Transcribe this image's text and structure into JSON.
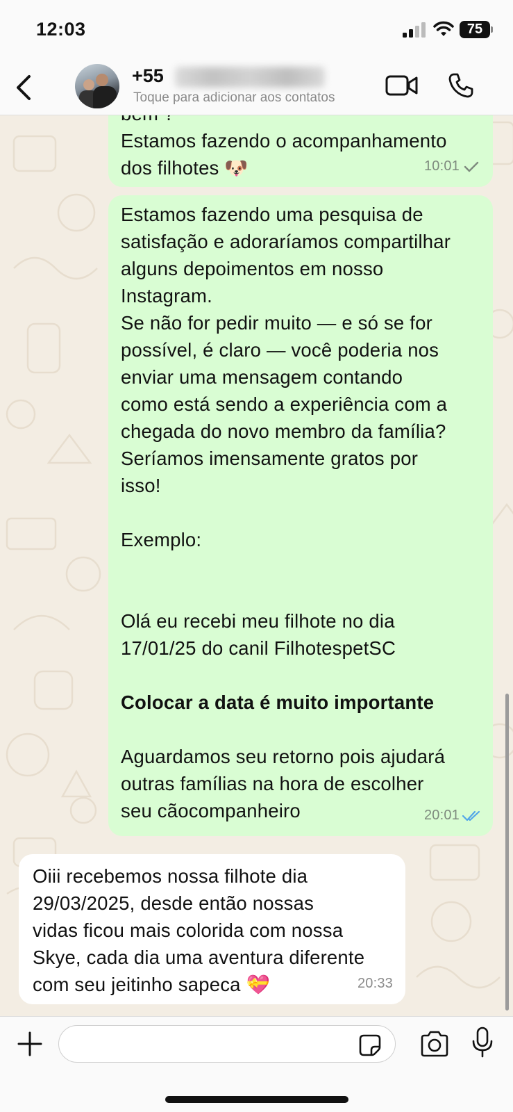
{
  "status_bar": {
    "time": "12:03",
    "battery": "75"
  },
  "header": {
    "contact_name": "+55",
    "contact_subtitle": "Toque para adicionar aos contatos",
    "icons": [
      "back-icon",
      "video-call-icon",
      "voice-call-icon"
    ]
  },
  "messages": [
    {
      "direction": "outgoing",
      "lines": [
        "bem ?",
        "Estamos fazendo o acompanhamento",
        "dos filhotes 🐶"
      ],
      "time": "10:01",
      "status": "sent"
    },
    {
      "direction": "outgoing",
      "lines": [
        "Estamos fazendo uma pesquisa de",
        "satisfação e adoraríamos compartilhar",
        "alguns depoimentos em nosso",
        "Instagram.",
        "Se não for pedir muito — e só se for",
        "possível, é claro — você poderia nos",
        "enviar uma mensagem contando",
        "como está sendo a experiência com a",
        "chegada do novo membro da família?",
        "Seríamos imensamente gratos por",
        "isso!",
        "",
        "Exemplo:",
        "",
        "",
        "Olá eu recebi meu filhote no dia",
        "17/01/25 do canil FilhotespetSC",
        "",
        "Colocar a data é muito importante",
        "",
        "Aguardamos seu retorno pois ajudará",
        "outras famílias na hora de escolher",
        "seu cãocompanheiro"
      ],
      "bold_line": "Colocar a data é muito importante",
      "time": "20:01",
      "status": "read"
    },
    {
      "direction": "incoming",
      "lines": [
        "Oiii recebemos nossa filhote dia",
        "29/03/2025, desde então nossas",
        "vidas ficou mais colorida com nossa",
        "Skye, cada dia uma aventura diferente",
        "com seu jeitinho sapeca 💝"
      ],
      "time": "20:33"
    }
  ],
  "input_bar": {
    "placeholder": "",
    "icons": [
      "plus-icon",
      "sticker-icon",
      "camera-icon",
      "microphone-icon"
    ]
  },
  "colors": {
    "outgoing_bubble": "#d9fdd3",
    "incoming_bubble": "#ffffff",
    "wallpaper": "#f3ede3",
    "read_tick": "#53a6e8"
  }
}
